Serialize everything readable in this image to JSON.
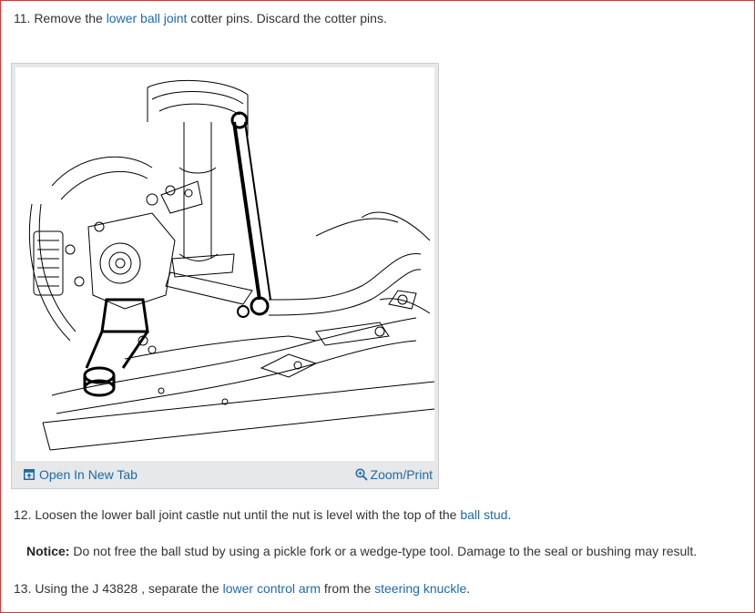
{
  "step11": {
    "prefix": "11. Remove the ",
    "link": "lower ball joint",
    "suffix": " cotter pins. Discard the cotter pins."
  },
  "figure": {
    "open_tab_label": "Open In New Tab",
    "zoom_print_label": "Zoom/Print",
    "icons": {
      "open_tab": "open-in-new-tab-icon",
      "zoom": "zoom-icon"
    }
  },
  "step12": {
    "prefix": "12. Loosen the lower ball joint castle nut until the nut is level with the top of the ",
    "link": "ball stud",
    "suffix": "."
  },
  "notice": {
    "label": "Notice:",
    "text": " Do not free the ball stud by using a pickle fork or a wedge-type tool. Damage to the seal or bushing may result."
  },
  "step13": {
    "prefix": "13. Using the J 43828 , separate the ",
    "link1": "lower control arm",
    "middle": " from the ",
    "link2": "steering knuckle",
    "suffix": "."
  },
  "colors": {
    "link": "#1f6aa5",
    "frame_border": "#c83c3c",
    "text": "#333333"
  }
}
